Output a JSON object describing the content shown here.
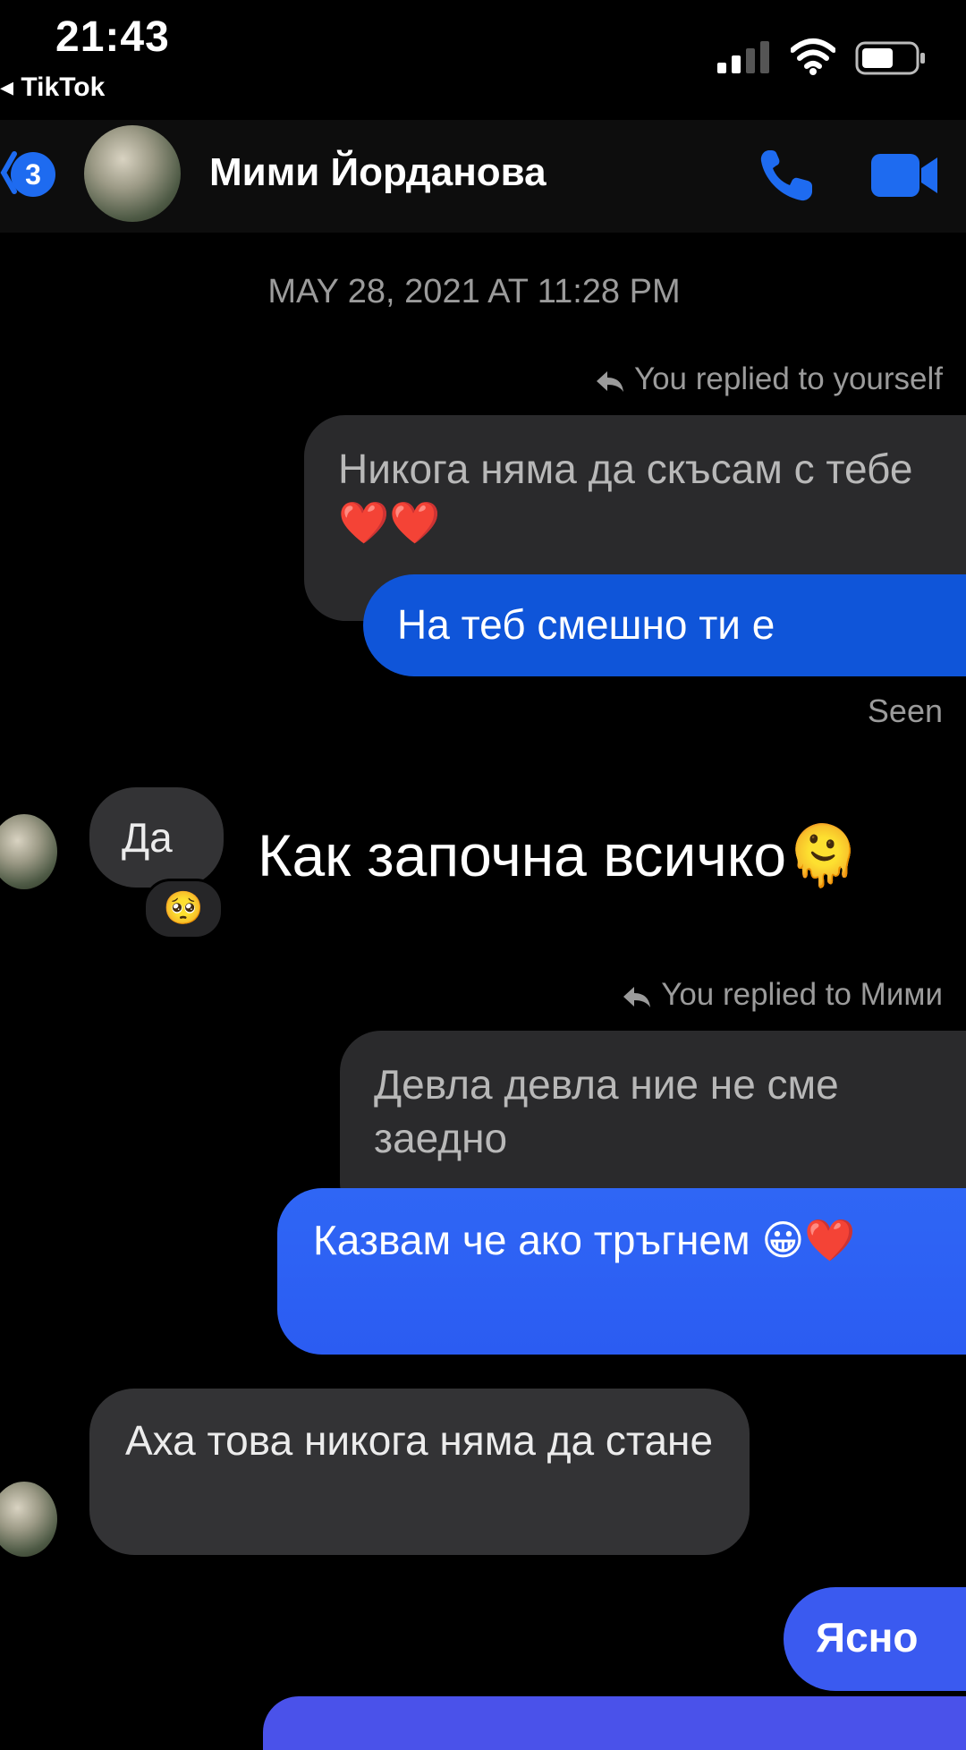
{
  "status_bar": {
    "time": "21:43",
    "back_app": "◂ TikTok",
    "icons": [
      "signal-icon",
      "wifi-icon",
      "battery-icon"
    ]
  },
  "header": {
    "unread_count": "3",
    "contact_name": "Мими Йорданова",
    "icons": [
      "back-chevron-icon",
      "phone-call-icon",
      "video-call-icon"
    ],
    "accent_color": "#1e6bf0"
  },
  "conversation": {
    "date_separator": "MAY 28, 2021 AT 11:28 PM",
    "reply1": {
      "label": "You replied to yourself",
      "quoted_text": "Никога няма да скъсам с тебе ❤️❤️",
      "message": "На теб смешно ти е"
    },
    "seen_label": "Seen",
    "received1": {
      "text": "Да",
      "reaction": "🥺"
    },
    "overlay_caption": "Как започна всичко🫠",
    "reply2": {
      "label": "You replied to Мими",
      "quoted_text": "Девла девла ние не сме заедно",
      "message": "Казвам че ако тръгнем 😀❤️"
    },
    "received2": {
      "text": "Аха това никога няма да стане"
    },
    "sent3": {
      "text": "Ясно"
    }
  },
  "colors": {
    "background": "#000000",
    "sent_bubble": "#2f66f5",
    "received_bubble": "#333335",
    "quoted_bubble": "#2a2a2c",
    "muted_text": "#9b9b9b"
  }
}
